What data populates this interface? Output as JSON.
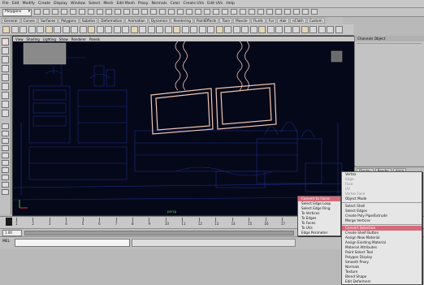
{
  "menubar": {
    "items": [
      "File",
      "Edit",
      "Modify",
      "Create",
      "Display",
      "Window",
      "Select",
      "Mesh",
      "Edit Mesh",
      "Proxy",
      "Normals",
      "Color",
      "Create UVs",
      "Edit UVs",
      "Help"
    ]
  },
  "status": {
    "mode": "Polygons"
  },
  "shelf": {
    "tabs": [
      "General",
      "Curves",
      "Surfaces",
      "Polygons",
      "Subdivs",
      "Deformation",
      "Animation",
      "Dynamics",
      "Rendering",
      "PaintEffects",
      "Toon",
      "Muscle",
      "Fluids",
      "Fur",
      "Hair",
      "nCloth",
      "Custom"
    ]
  },
  "viewport": {
    "panel_menu": [
      "View",
      "Shading",
      "Lighting",
      "Show",
      "Renderer",
      "Panels"
    ],
    "camera_label": "persp",
    "bg_color": "#050818",
    "wire_color": "#1d2e8c",
    "selected_color": "#f2c6b5"
  },
  "channelbox": {
    "title": "Channels  Object",
    "tab": "Channel Box / Layer Editor"
  },
  "layers": {
    "tabs": [
      "Display",
      "Render",
      "Anim"
    ]
  },
  "timeline": {
    "ticks": [
      "1",
      "2",
      "3",
      "4",
      "5",
      "6",
      "7",
      "8",
      "9",
      "10",
      "11",
      "12",
      "13",
      "14",
      "15",
      "16",
      "17",
      "18",
      "19",
      "20",
      "21",
      "22",
      "23",
      "24"
    ],
    "current_frame": "1.00"
  },
  "range": {
    "start": "1.00",
    "end": "24.00"
  },
  "cmd": {
    "label": "MEL"
  },
  "context_menu": {
    "left": {
      "items": [
        "Convert to Faces",
        "Select Edge Loop",
        "Select Edge Ring",
        "To Vertices",
        "To Edges",
        "To Faces",
        "To UVs",
        "Edge Perimeter"
      ]
    },
    "main": {
      "items": [
        "Vertex",
        "Edge",
        "Face",
        "UV",
        "Vertex Face",
        "Object Mode",
        "Select Shell",
        "Select Edges",
        "Create Poly Pipe/Extrude",
        "Merge Vertices",
        "Convert Selection",
        "Create Shelf Button",
        "Assign New Material",
        "Assign Existing Material",
        "Material Attributes",
        "Paint Select Tool",
        "Polygon Display",
        "Smooth Proxy",
        "Normals",
        "Texture",
        "Blend Shape",
        "Edit Deformers"
      ]
    }
  }
}
